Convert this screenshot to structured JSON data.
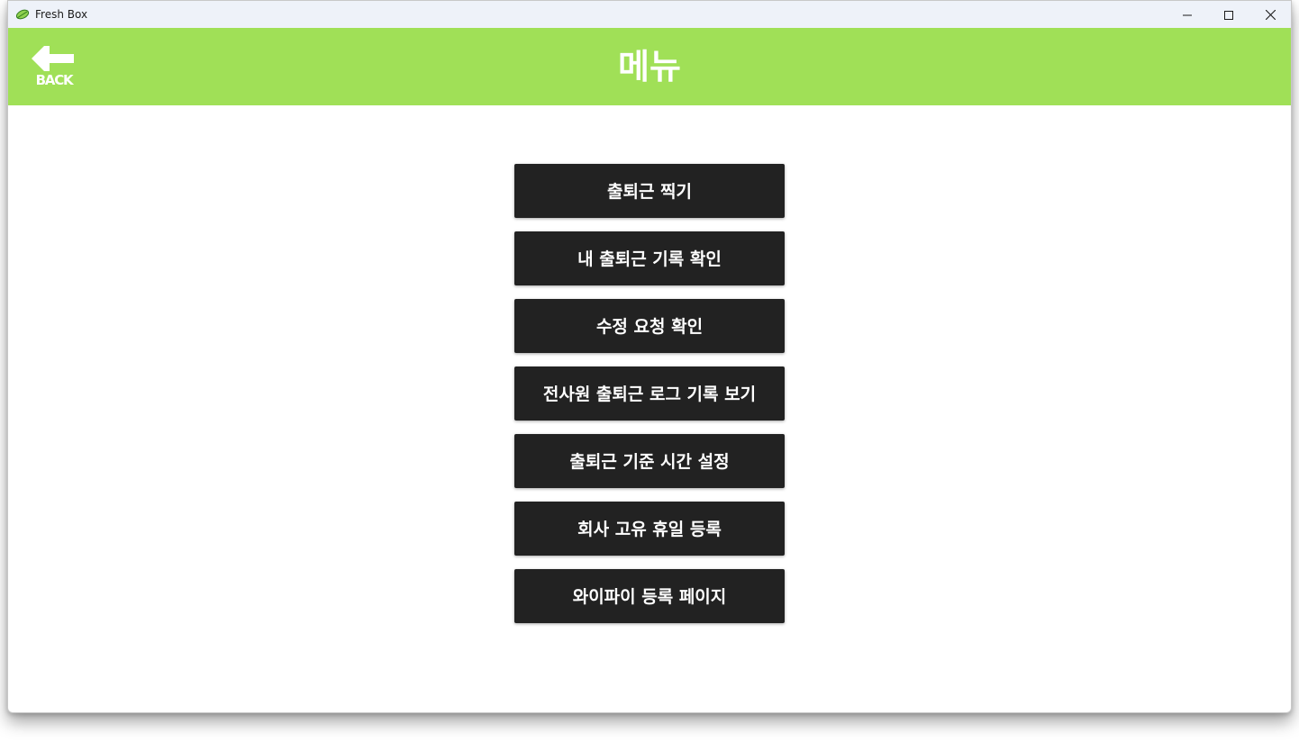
{
  "window": {
    "title": "Fresh Box",
    "app_icon": "leaf-icon",
    "controls": [
      "minimize-icon",
      "maximize-icon",
      "close-icon"
    ]
  },
  "header": {
    "back_label": "BACK",
    "back_icon": "arrow-left-icon",
    "title": "메뉴",
    "background_color": "#a0e057"
  },
  "menu": {
    "button_color": "#222222",
    "items": [
      {
        "label": "출퇴근 찍기"
      },
      {
        "label": "내 출퇴근 기록 확인"
      },
      {
        "label": "수정 요청 확인"
      },
      {
        "label": "전사원 출퇴근 로그 기록 보기"
      },
      {
        "label": "출퇴근 기준 시간 설정"
      },
      {
        "label": "회사 고유 휴일 등록"
      },
      {
        "label": "와이파이 등록 페이지"
      }
    ]
  }
}
